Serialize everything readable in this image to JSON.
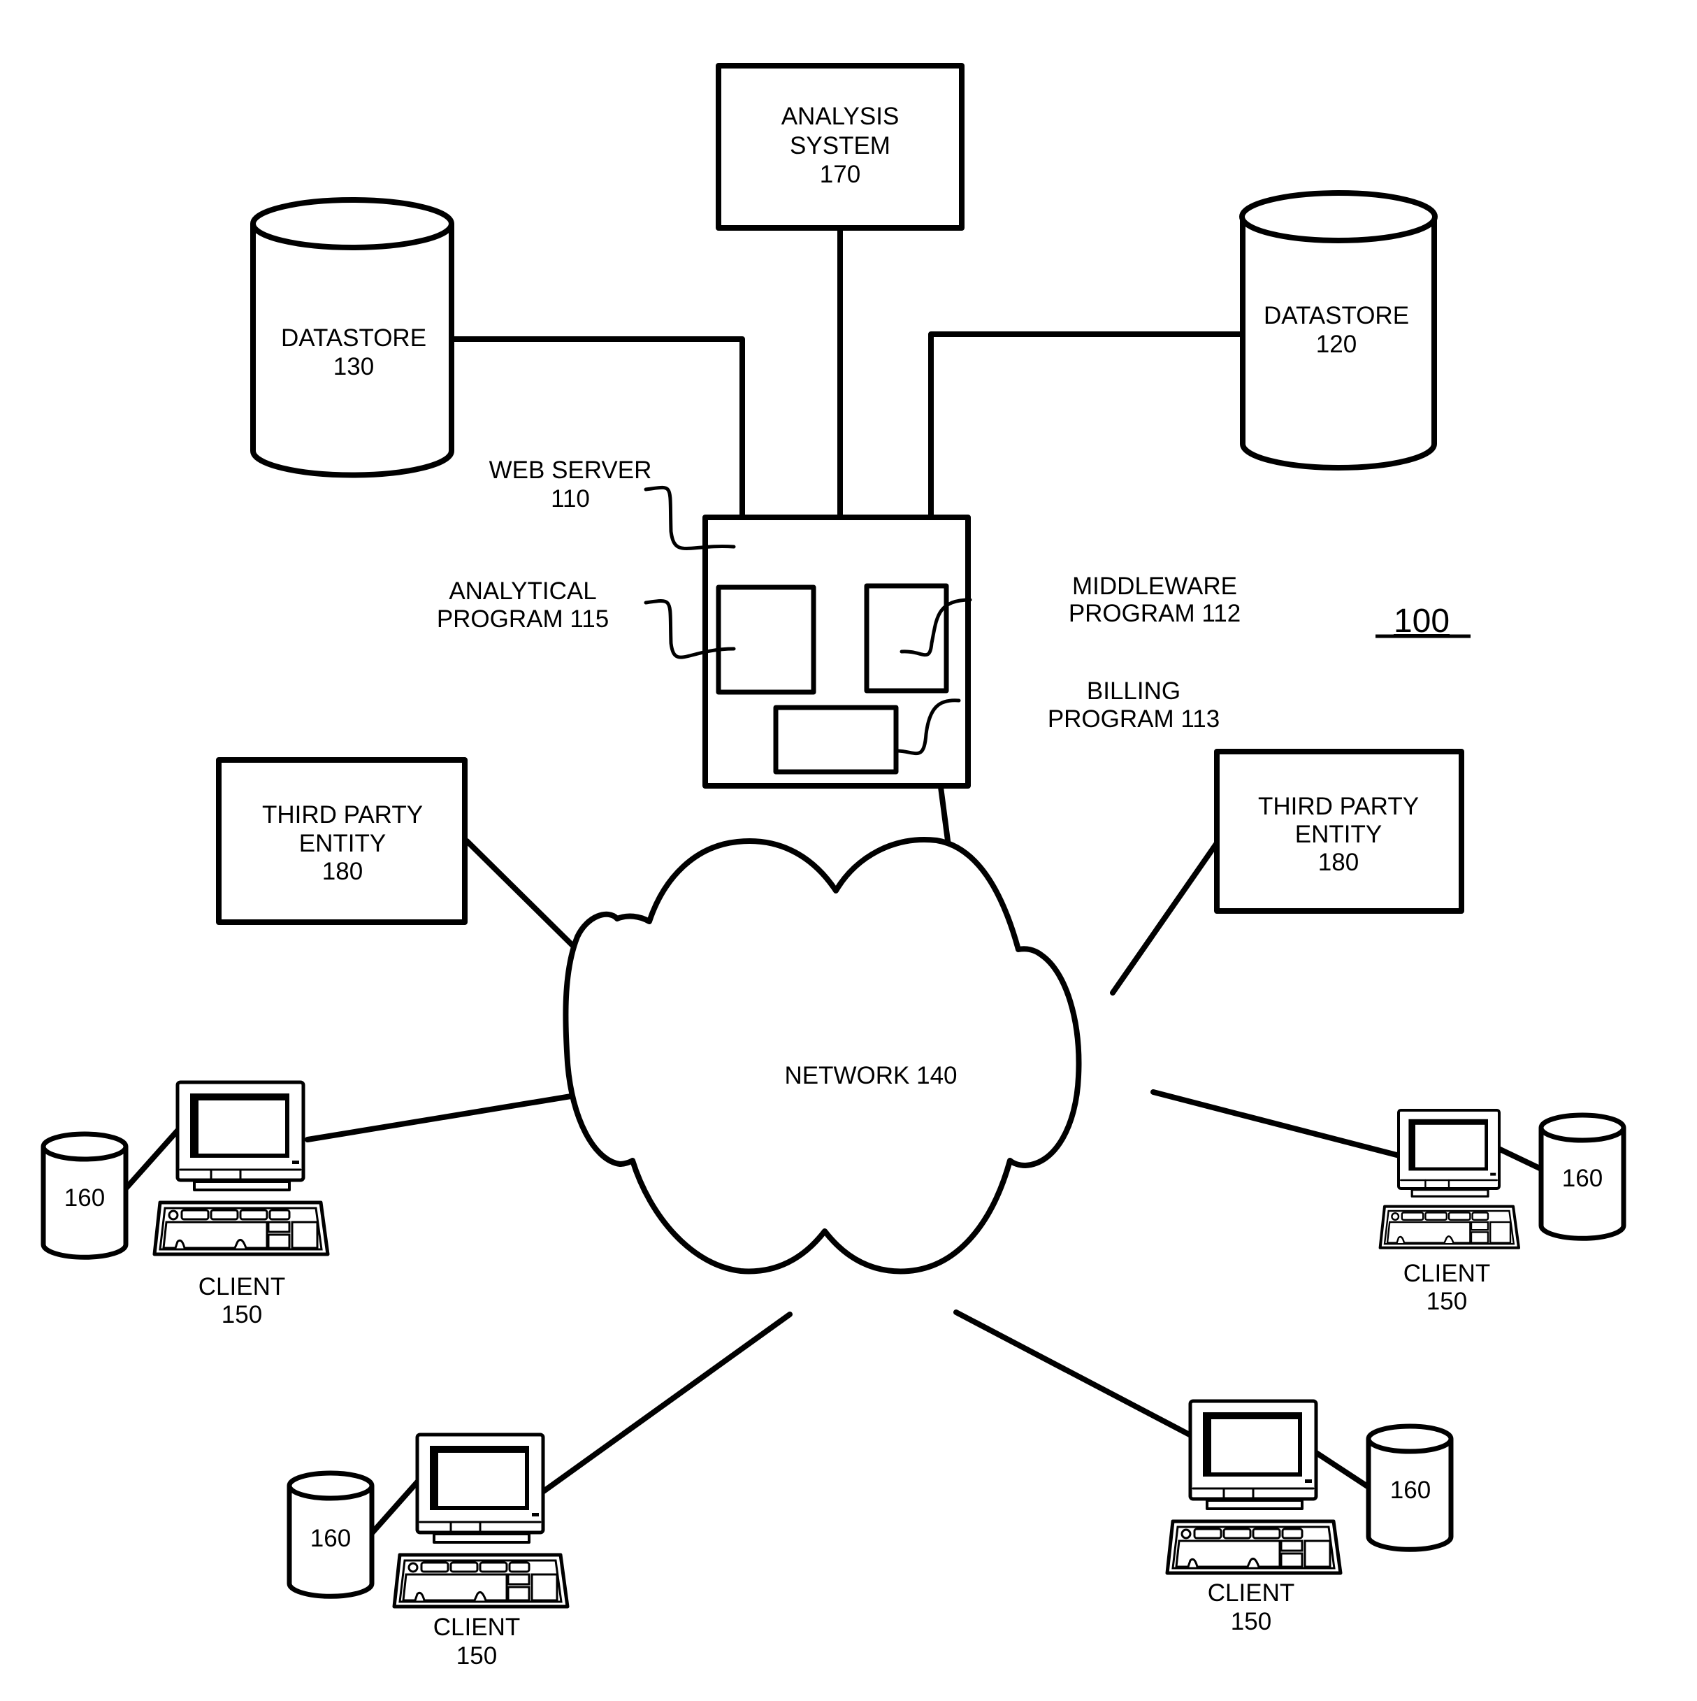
{
  "figure": {
    "reference_numeral": "100",
    "colors": {
      "ink": "#000000",
      "paper": "#ffffff"
    }
  },
  "analysis_system": {
    "line1": "ANALYSIS",
    "line2": "SYSTEM",
    "number": "170"
  },
  "datastore_130": {
    "line1": "DATASTORE",
    "number": "130"
  },
  "datastore_120": {
    "line1": "DATASTORE",
    "number": "120"
  },
  "web_server": {
    "label_line1": "WEB SERVER",
    "label_line2": "110",
    "analytical_program": {
      "line1": "ANALYTICAL",
      "line2": "PROGRAM 115"
    },
    "middleware_program": {
      "line1": "MIDDLEWARE",
      "line2": "PROGRAM 112"
    },
    "billing_program": {
      "line1": "BILLING",
      "line2": "PROGRAM 113"
    }
  },
  "third_party_left": {
    "line1": "THIRD PARTY",
    "line2": "ENTITY",
    "number": "180"
  },
  "third_party_right": {
    "line1": "THIRD PARTY",
    "line2": "ENTITY",
    "number": "180"
  },
  "network": {
    "label": "NETWORK 140"
  },
  "clients": [
    {
      "position": "left",
      "label": "CLIENT",
      "number": "150",
      "storage": "160"
    },
    {
      "position": "right",
      "label": "CLIENT",
      "number": "150",
      "storage": "160"
    },
    {
      "position": "bottom-left",
      "label": "CLIENT",
      "number": "150",
      "storage": "160"
    },
    {
      "position": "bottom-right",
      "label": "CLIENT",
      "number": "150",
      "storage": "160"
    }
  ],
  "icons": {
    "datastore": "cylinder-icon",
    "client": "desktop-computer-icon",
    "network": "cloud-icon"
  }
}
